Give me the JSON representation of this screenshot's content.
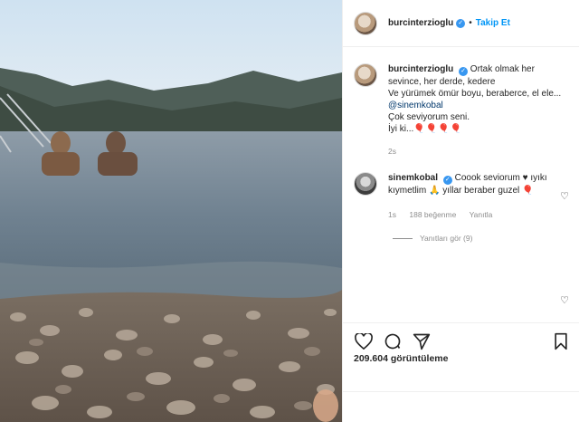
{
  "post": {
    "author": "burcinterzioglu",
    "follow_label": "Takip Et",
    "separator": "•"
  },
  "caption": {
    "user": "burcinterzioglu",
    "text_line1": "Ortak olmak her sevince, her derde, kedere",
    "text_line2": "Ve yürümek ömür boyu, beraberce, el ele...",
    "mention": "@sinemkobal",
    "text_line3": "Çok seviyorum seni.",
    "text_line4": "İyi ki...",
    "emoji": "🎈🎈🎈🎈",
    "time": "2s"
  },
  "reply": {
    "user": "sinemkobal",
    "text": "Coook seviorum ♥ ıyıkı kıymetlim 🙏 yıllar beraber guzel",
    "emoji": "🎈",
    "time": "1s",
    "likes": "188 beğenme",
    "reply_label": "Yanıtla",
    "view_replies": "Yanıtları gör (9)"
  },
  "footer": {
    "views": "209.604 görüntüleme"
  },
  "colors": {
    "accent": "#0095f6",
    "verified": "#3897f0",
    "muted": "#8e8e8e"
  }
}
